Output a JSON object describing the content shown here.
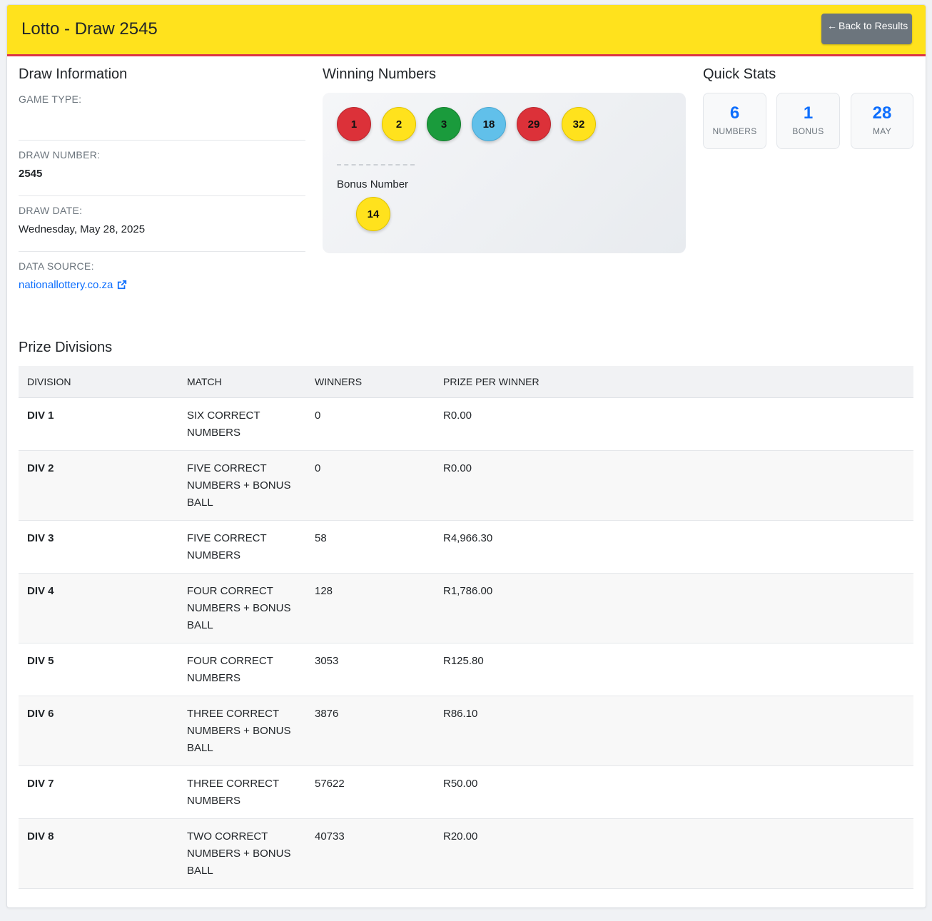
{
  "header": {
    "title": "Lotto - Draw 2545",
    "back_label": "Back to Results"
  },
  "draw_info": {
    "heading": "Draw Information",
    "fields": [
      {
        "label": "GAME TYPE:",
        "value": ""
      },
      {
        "label": "DRAW NUMBER:",
        "value": "2545"
      },
      {
        "label": "DRAW DATE:",
        "value": "Wednesday, May 28, 2025"
      },
      {
        "label": "DATA SOURCE:",
        "value": "nationallottery.co.za"
      }
    ]
  },
  "winning": {
    "heading": "Winning Numbers",
    "balls": [
      {
        "number": "1",
        "color": "red"
      },
      {
        "number": "2",
        "color": "yellow"
      },
      {
        "number": "3",
        "color": "green"
      },
      {
        "number": "18",
        "color": "blue"
      },
      {
        "number": "29",
        "color": "red"
      },
      {
        "number": "32",
        "color": "yellow"
      }
    ],
    "bonus_label": "Bonus Number",
    "bonus": {
      "number": "14",
      "color": "yellow"
    }
  },
  "quick_stats": {
    "heading": "Quick Stats",
    "items": [
      {
        "value": "6",
        "label": "NUMBERS"
      },
      {
        "value": "1",
        "label": "BONUS"
      },
      {
        "value": "28",
        "label": "MAY"
      }
    ]
  },
  "prizes": {
    "heading": "Prize Divisions",
    "columns": [
      "DIVISION",
      "MATCH",
      "WINNERS",
      "PRIZE PER WINNER"
    ],
    "rows": [
      {
        "division": "DIV 1",
        "match": "SIX CORRECT NUMBERS",
        "winners": "0",
        "prize": "R0.00"
      },
      {
        "division": "DIV 2",
        "match": "FIVE CORRECT NUMBERS + BONUS BALL",
        "winners": "0",
        "prize": "R0.00"
      },
      {
        "division": "DIV 3",
        "match": "FIVE CORRECT NUMBERS",
        "winners": "58",
        "prize": "R4,966.30"
      },
      {
        "division": "DIV 4",
        "match": "FOUR CORRECT NUMBERS + BONUS BALL",
        "winners": "128",
        "prize": "R1,786.00"
      },
      {
        "division": "DIV 5",
        "match": "FOUR CORRECT NUMBERS",
        "winners": "3053",
        "prize": "R125.80"
      },
      {
        "division": "DIV 6",
        "match": "THREE CORRECT NUMBERS + BONUS BALL",
        "winners": "3876",
        "prize": "R86.10"
      },
      {
        "division": "DIV 7",
        "match": "THREE CORRECT NUMBERS",
        "winners": "57622",
        "prize": "R50.00"
      },
      {
        "division": "DIV 8",
        "match": "TWO CORRECT NUMBERS + BONUS BALL",
        "winners": "40733",
        "prize": "R20.00"
      }
    ]
  },
  "colors": {
    "header_bg": "#ffe21d",
    "header_border": "#dc3545",
    "accent": "#0d6efd",
    "ball_red": "#dc3139",
    "ball_yellow": "#ffe21d",
    "ball_green": "#1a9b3c",
    "ball_blue": "#61c0ea"
  }
}
